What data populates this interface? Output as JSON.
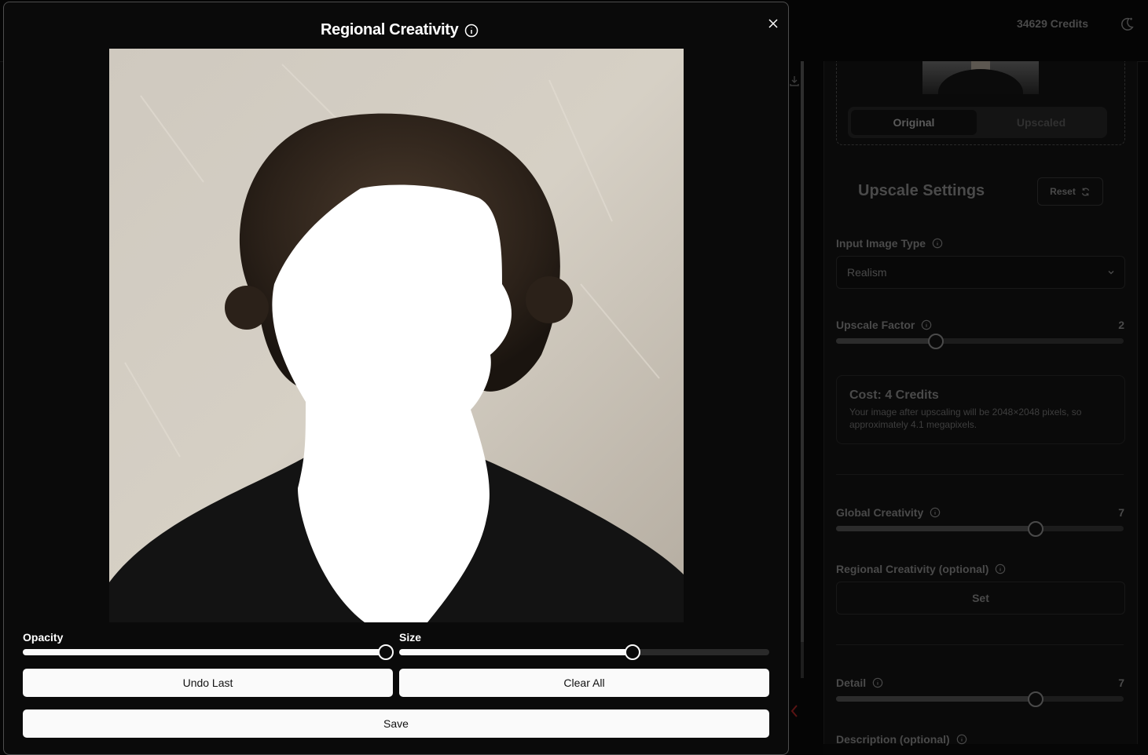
{
  "header": {
    "credits": "34629 Credits"
  },
  "sidebar": {
    "view_tabs": [
      "Original",
      "Upscaled"
    ],
    "settings_title": "Upscale Settings",
    "reset_label": "Reset",
    "input_image_type": {
      "label": "Input Image Type",
      "value": "Realism"
    },
    "upscale_factor": {
      "label": "Upscale Factor",
      "value": "2",
      "fraction": 0.345
    },
    "cost": {
      "title": "Cost: 4 Credits",
      "description": "Your image after upscaling will be 2048×2048 pixels, so approximately 4.1 megapixels."
    },
    "global_creativity": {
      "label": "Global Creativity",
      "value": "7",
      "fraction": 0.69
    },
    "regional_creativity": {
      "label": "Regional Creativity (optional)",
      "button": "Set"
    },
    "detail": {
      "label": "Detail",
      "value": "7",
      "fraction": 0.69
    },
    "description": {
      "label": "Description (optional)"
    }
  },
  "modal": {
    "title": "Regional Creativity",
    "opacity": {
      "label": "Opacity",
      "fraction": 0.98
    },
    "size": {
      "label": "Size",
      "fraction": 0.63
    },
    "undo_label": "Undo Last",
    "clear_label": "Clear All",
    "save_label": "Save"
  },
  "colors": {
    "mask": "#ffffff",
    "button_bg": "#fafafa",
    "modal_bg": "#0a0a0a"
  },
  "icons": [
    "info-icon",
    "close-icon",
    "moon-icon",
    "download-icon",
    "chevron-down-icon",
    "refresh-icon"
  ]
}
